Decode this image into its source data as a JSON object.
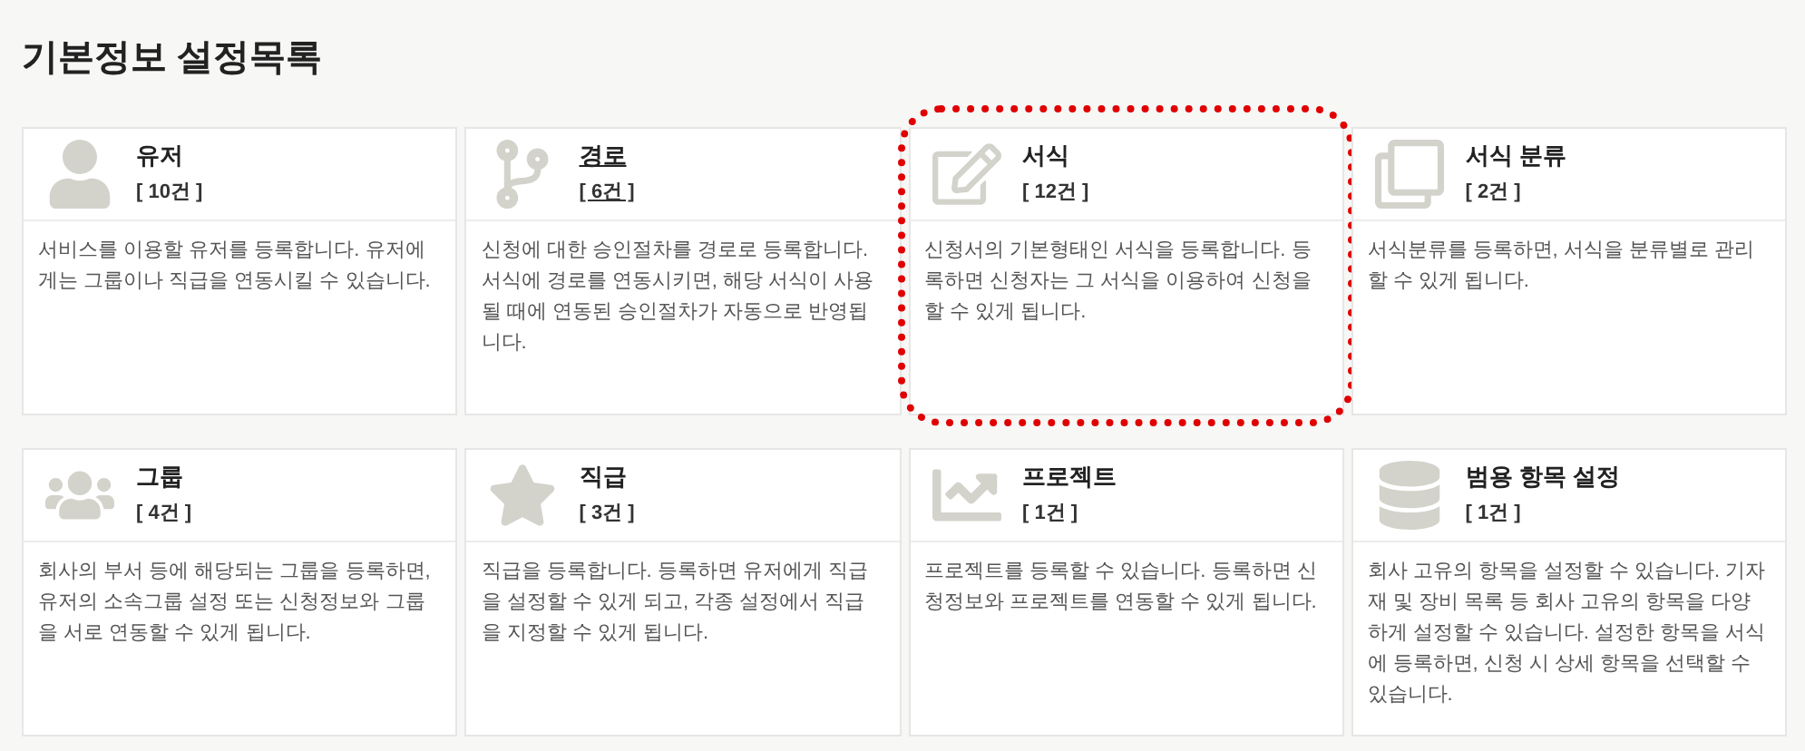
{
  "page_title": "기본정보 설정목록",
  "cards": [
    {
      "title": "유저",
      "count": "[ 10건 ]",
      "description": "서비스를 이용할 유저를 등록합니다. 유저에게는 그룹이나 직급을 연동시킬 수 있습니다.",
      "underlined": false,
      "highlighted": false
    },
    {
      "title": "경로",
      "count": "[ 6건 ]",
      "description": "신청에 대한 승인절차를 경로로 등록합니다. 서식에 경로를 연동시키면, 해당 서식이 사용될 때에 연동된 승인절차가 자동으로 반영됩니다.",
      "underlined": true,
      "highlighted": false
    },
    {
      "title": "서식",
      "count": "[ 12건 ]",
      "description": "신청서의 기본형태인 서식을 등록합니다. 등록하면 신청자는 그 서식을 이용하여 신청을 할 수 있게 됩니다.",
      "underlined": false,
      "highlighted": true
    },
    {
      "title": "서식 분류",
      "count": "[ 2건 ]",
      "description": "서식분류를 등록하면, 서식을 분류별로 관리할 수 있게 됩니다.",
      "underlined": false,
      "highlighted": false
    },
    {
      "title": "그룹",
      "count": "[ 4건 ]",
      "description": "회사의 부서 등에 해당되는 그룹을 등록하면, 유저의 소속그룹 설정 또는 신청정보와 그룹을 서로 연동할 수 있게 됩니다.",
      "underlined": false,
      "highlighted": false
    },
    {
      "title": "직급",
      "count": "[ 3건 ]",
      "description": "직급을 등록합니다. 등록하면 유저에게 직급을 설정할 수 있게 되고, 각종 설정에서 직급을 지정할 수 있게 됩니다.",
      "underlined": false,
      "highlighted": false
    },
    {
      "title": "프로젝트",
      "count": "[ 1건 ]",
      "description": "프로젝트를 등록할 수 있습니다. 등록하면 신청정보와 프로젝트를 연동할 수 있게 됩니다.",
      "underlined": false,
      "highlighted": false
    },
    {
      "title": "범용 항목 설정",
      "count": "[ 1건 ]",
      "description": "회사 고유의 항목을 설정할 수 있습니다. 기자재 및 장비 목록 등 회사 고유의 항목을 다양하게 설정할 수 있습니다. 설정한 항목을 서식에 등록하면, 신청 시 상세 항목을 선택할 수 있습니다.",
      "underlined": false,
      "highlighted": false
    }
  ]
}
